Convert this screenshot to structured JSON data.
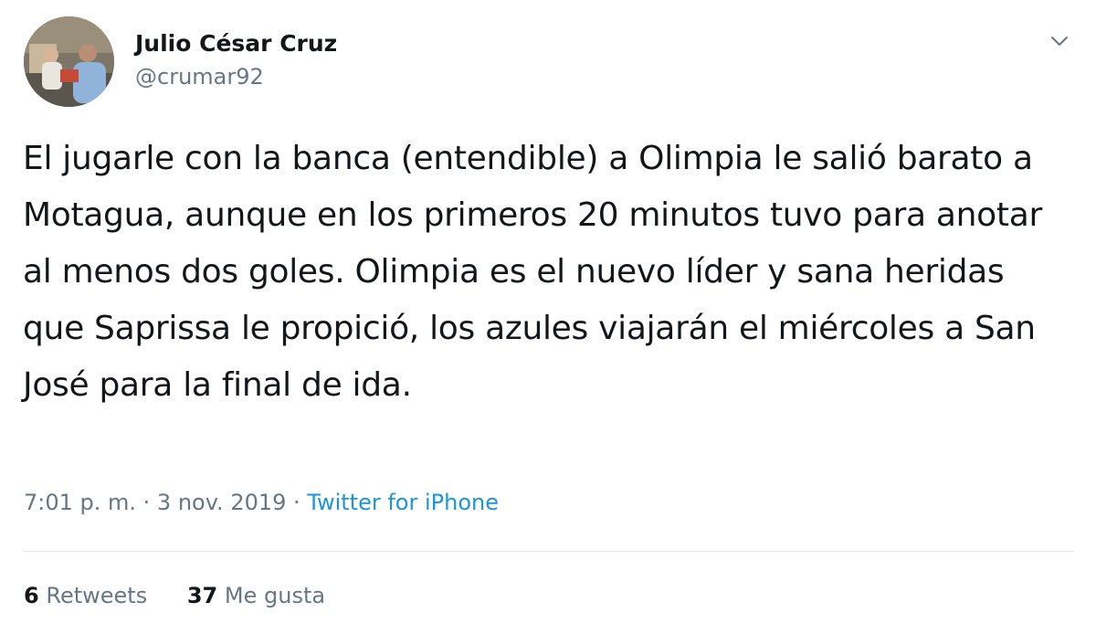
{
  "author": {
    "name": "Julio César Cruz",
    "handle": "@crumar92"
  },
  "tweet": {
    "text": "El jugarle con la banca (entendible) a Olimpia le salió barato a Motagua, aunque en los primeros 20 minutos tuvo para anotar al menos dos goles. Olimpia es el nuevo líder y sana heridas que Saprissa le propició, los azules viajarán el miércoles a San José para la final de ida.",
    "time": "7:01 p. m.",
    "separator": " · ",
    "date": "3 nov. 2019",
    "source": "Twitter for iPhone"
  },
  "stats": {
    "retweets_count": "6",
    "retweets_label": "Retweets",
    "likes_count": "37",
    "likes_label": "Me gusta"
  },
  "icons": {
    "menu": "chevron-down-icon"
  },
  "colors": {
    "text": "#14171a",
    "muted": "#657786",
    "link": "#1b95e0",
    "divider": "#e6ecf0"
  }
}
